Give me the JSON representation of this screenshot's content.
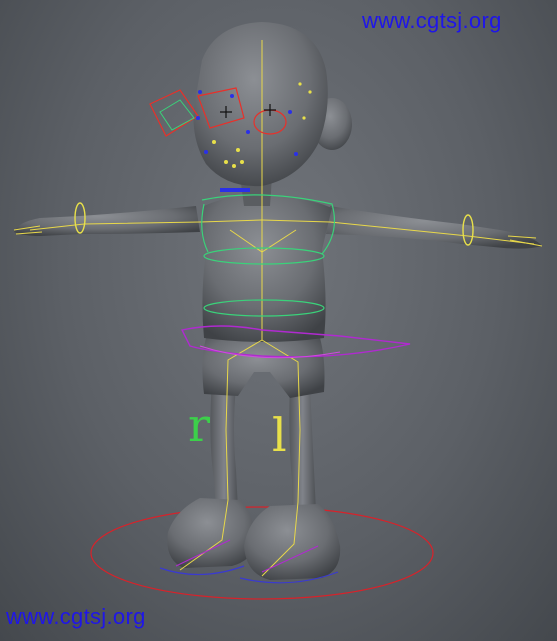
{
  "watermark": {
    "top_text": "www.cgtsj.org",
    "bottom_text": "www.cgtsj.org"
  },
  "rig": {
    "right_label": "r",
    "left_label": "l"
  },
  "colors": {
    "watermark": "#1f16e8",
    "viewport_bg": "#5c6066",
    "mesh": "#6a6c70",
    "foot_circle": "#d8222a",
    "hip_control": "#b02ad0",
    "spine_control": "#3ad27a",
    "joint_line": "#e8d84a",
    "face_control": "#e8302a",
    "right_label": "#3cd04a",
    "left_label": "#e8e04a"
  }
}
